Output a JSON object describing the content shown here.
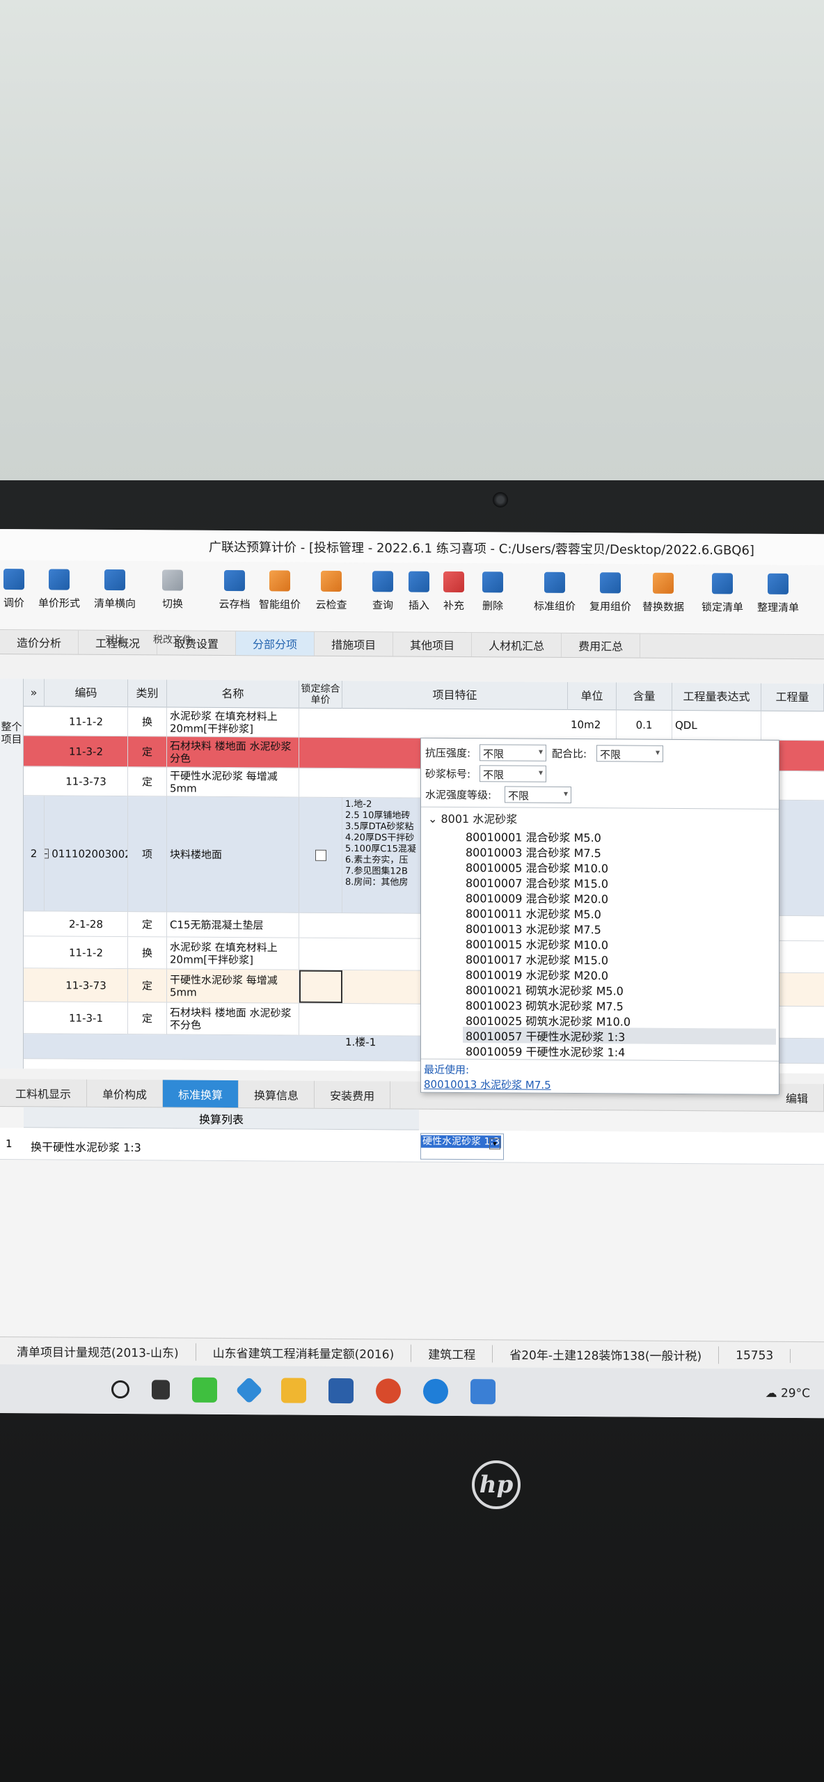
{
  "window": {
    "title": "广联达预算计价 - [投标管理 - 2022.6.1 练习喜项 - C:/Users/蓉蓉宝贝/Desktop/2022.6.GBQ6]"
  },
  "toolbar": {
    "items": [
      {
        "label": "调价",
        "icon": "adjust-price-icon"
      },
      {
        "label": "单价形式",
        "icon": "unit-price-icon"
      },
      {
        "label": "清单横向",
        "sub": "对比",
        "icon": "compare-icon"
      },
      {
        "label": "切换",
        "sub": "税改文件",
        "icon": "switch-icon"
      },
      {
        "label": "云存档",
        "icon": "cloud-save-icon"
      },
      {
        "label": "智能组价",
        "icon": "smart-price-icon"
      },
      {
        "label": "云检查",
        "icon": "cloud-check-icon"
      },
      {
        "label": "查询",
        "icon": "query-icon"
      },
      {
        "label": "插入",
        "icon": "insert-icon"
      },
      {
        "label": "补充",
        "icon": "supplement-icon"
      },
      {
        "label": "删除",
        "icon": "delete-icon"
      },
      {
        "label": "标准组价",
        "icon": "standard-price-icon"
      },
      {
        "label": "复用组价",
        "icon": "reuse-price-icon"
      },
      {
        "label": "替换数据",
        "icon": "replace-data-icon"
      },
      {
        "label": "锁定清单",
        "icon": "lock-list-icon"
      },
      {
        "label": "整理清单",
        "icon": "organize-list-icon"
      }
    ]
  },
  "tabs": [
    "造价分析",
    "工程概况",
    "取费设置",
    "分部分项",
    "措施项目",
    "其他项目",
    "人材机汇总",
    "费用汇总"
  ],
  "active_tab": "分部分项",
  "sidebar": {
    "label": "整个项目"
  },
  "grid": {
    "headers": [
      "编码",
      "类别",
      "名称",
      "锁定综合单价",
      "项目特征",
      "单位",
      "含量",
      "工程量表达式",
      "工程量"
    ],
    "rows": [
      {
        "num": "",
        "code": "11-1-2",
        "type": "换",
        "name": "水泥砂浆 在填充材料上 20mm[干拌砂浆]",
        "unit": "10m2",
        "qty": "0.1",
        "expr": "QDL",
        "feature": ""
      },
      {
        "num": "",
        "code": "11-3-2",
        "type": "定",
        "name": "石材块料 楼地面 水泥砂浆 分色",
        "unit": "",
        "qty": "",
        "expr": "",
        "feature": ""
      },
      {
        "num": "",
        "code": "11-3-73",
        "type": "定",
        "name": "干硬性水泥砂浆 每增减5mm",
        "unit": "",
        "qty": "",
        "expr": "",
        "feature": ""
      },
      {
        "num": "2",
        "code": "011102003002",
        "type": "项",
        "name": "块料楼地面",
        "unit": "",
        "qty": "",
        "expr": "",
        "feature": "1.地-2\n2.5 10厚铺地砖\n3.5厚DTA砂浆粘\n4.20厚DS干拌砂\n5.100厚C15混凝\n6.素土夯实，压\n7.参见图集12B\n8.房间：其他房"
      },
      {
        "num": "",
        "code": "2-1-28",
        "type": "定",
        "name": "C15无筋混凝土垫层",
        "unit": "",
        "qty": "",
        "expr": "",
        "feature": ""
      },
      {
        "num": "",
        "code": "11-1-2",
        "type": "换",
        "name": "水泥砂浆 在填充材料上 20mm[干拌砂浆]",
        "unit": "",
        "qty": "",
        "expr": "",
        "feature": ""
      },
      {
        "num": "",
        "code": "11-3-73",
        "type": "定",
        "name": "干硬性水泥砂浆 每增减5mm",
        "unit": "",
        "qty": "",
        "expr": "",
        "feature": ""
      },
      {
        "num": "",
        "code": "11-3-1",
        "type": "定",
        "name": "石材块料 楼地面 水泥砂浆 不分色",
        "unit": "",
        "qty": "",
        "expr": "",
        "feature": ""
      },
      {
        "num": "",
        "code": "",
        "type": "",
        "name": "",
        "unit": "",
        "qty": "",
        "expr": "",
        "feature": "1.楼-1"
      }
    ]
  },
  "dropdown": {
    "filters": {
      "kyqd_label": "抗压强度:",
      "kyqd_value": "不限",
      "phb_label": "配合比:",
      "phb_value": "不限",
      "sjbh_label": "砂浆标号:",
      "sjbh_value": "不限",
      "snqd_label": "水泥强度等级:",
      "snqd_value": "不限"
    },
    "tree_head": "8001 水泥砂浆",
    "options": [
      "80010001 混合砂浆 M5.0",
      "80010003 混合砂浆 M7.5",
      "80010005 混合砂浆 M10.0",
      "80010007 混合砂浆 M15.0",
      "80010009 混合砂浆 M20.0",
      "80010011 水泥砂浆 M5.0",
      "80010013 水泥砂浆 M7.5",
      "80010015 水泥砂浆 M10.0",
      "80010017 水泥砂浆 M15.0",
      "80010019 水泥砂浆 M20.0",
      "80010021 砌筑水泥砂浆 M5.0",
      "80010023 砌筑水泥砂浆 M7.5",
      "80010025 砌筑水泥砂浆 M10.0",
      "80010057 干硬性水泥砂浆 1:3",
      "80010059 干硬性水泥砂浆 1:4"
    ],
    "selected_index": 13,
    "recent_label": "最近使用:",
    "recent_link": "80010013 水泥砂浆 M7.5"
  },
  "lower": {
    "tabs": [
      "工料机显示",
      "单价构成",
      "标准换算",
      "换算信息",
      "安装费用"
    ],
    "active": "标准换算",
    "list_title": "换算列表",
    "row_num": "1",
    "row_text": "换干硬性水泥砂浆 1:3",
    "edit_value": "硬性水泥砂浆 1:3",
    "right_hint": "编辑"
  },
  "statusbar": {
    "items": [
      "清单项目计量规范(2013-山东)",
      "山东省建筑工程消耗量定额(2016)",
      "建筑工程",
      "省20年-土建128装饰138(一般计税)",
      "15753"
    ]
  },
  "taskbar": {
    "weather": "29°C"
  },
  "laptop": {
    "brand": "hp"
  }
}
